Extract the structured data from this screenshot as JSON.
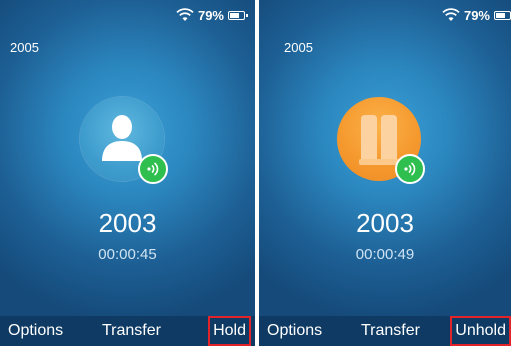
{
  "screens": [
    {
      "status": {
        "battery_text": "79%"
      },
      "extension": "2005",
      "call": {
        "number": "2003",
        "duration": "00:00:45",
        "state_icon": "user-icon"
      },
      "softkeys": {
        "left": "Options",
        "middle": "Transfer",
        "right": "Hold"
      }
    },
    {
      "status": {
        "battery_text": "79%"
      },
      "extension": "2005",
      "call": {
        "number": "2003",
        "duration": "00:00:49",
        "state_icon": "pause-icon"
      },
      "softkeys": {
        "left": "Options",
        "middle": "Transfer",
        "right": "Unhold"
      }
    }
  ],
  "battery_level": 0.79,
  "colors": {
    "highlight": "#e0242a",
    "active_badge": "#2fbf4e",
    "hold_accent": "#f59a2f"
  }
}
